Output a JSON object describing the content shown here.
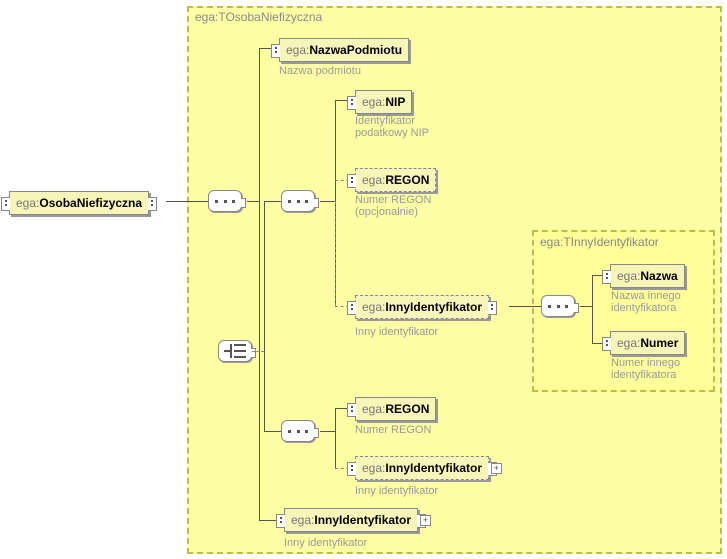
{
  "root": {
    "prefix": "ega:",
    "name": "OsobaNiefizyczna"
  },
  "mainGroup": {
    "title": "ega:TOsobaNiefizyczna"
  },
  "innerGroup": {
    "title": "ega:TInnyIdentyfikator"
  },
  "nazwaPodmiotu": {
    "prefix": "ega:",
    "name": "NazwaPodmiotu",
    "caption": "Nazwa podmiotu"
  },
  "nip": {
    "prefix": "ega:",
    "name": "NIP",
    "caption": "Identyfikator podatkowy NIP"
  },
  "regon1": {
    "prefix": "ega:",
    "name": "REGON",
    "caption": "Numer REGON (opcjonalnie)"
  },
  "innyId1": {
    "prefix": "ega:",
    "name": "InnyIdentyfikator",
    "caption": "Inny identyfikator"
  },
  "regon2": {
    "prefix": "ega:",
    "name": "REGON",
    "caption": "Numer REGON"
  },
  "innyId2": {
    "prefix": "ega:",
    "name": "InnyIdentyfikator",
    "caption": "Inny identyfikator"
  },
  "innyId3": {
    "prefix": "ega:",
    "name": "InnyIdentyfikator",
    "caption": "Inny identyfikator"
  },
  "nazwa": {
    "prefix": "ega:",
    "name": "Nazwa",
    "caption": "Nazwa innego identyfikatora"
  },
  "numer": {
    "prefix": "ega:",
    "name": "Numer",
    "caption": "Numer innego identyfikatora"
  },
  "expand": "+"
}
